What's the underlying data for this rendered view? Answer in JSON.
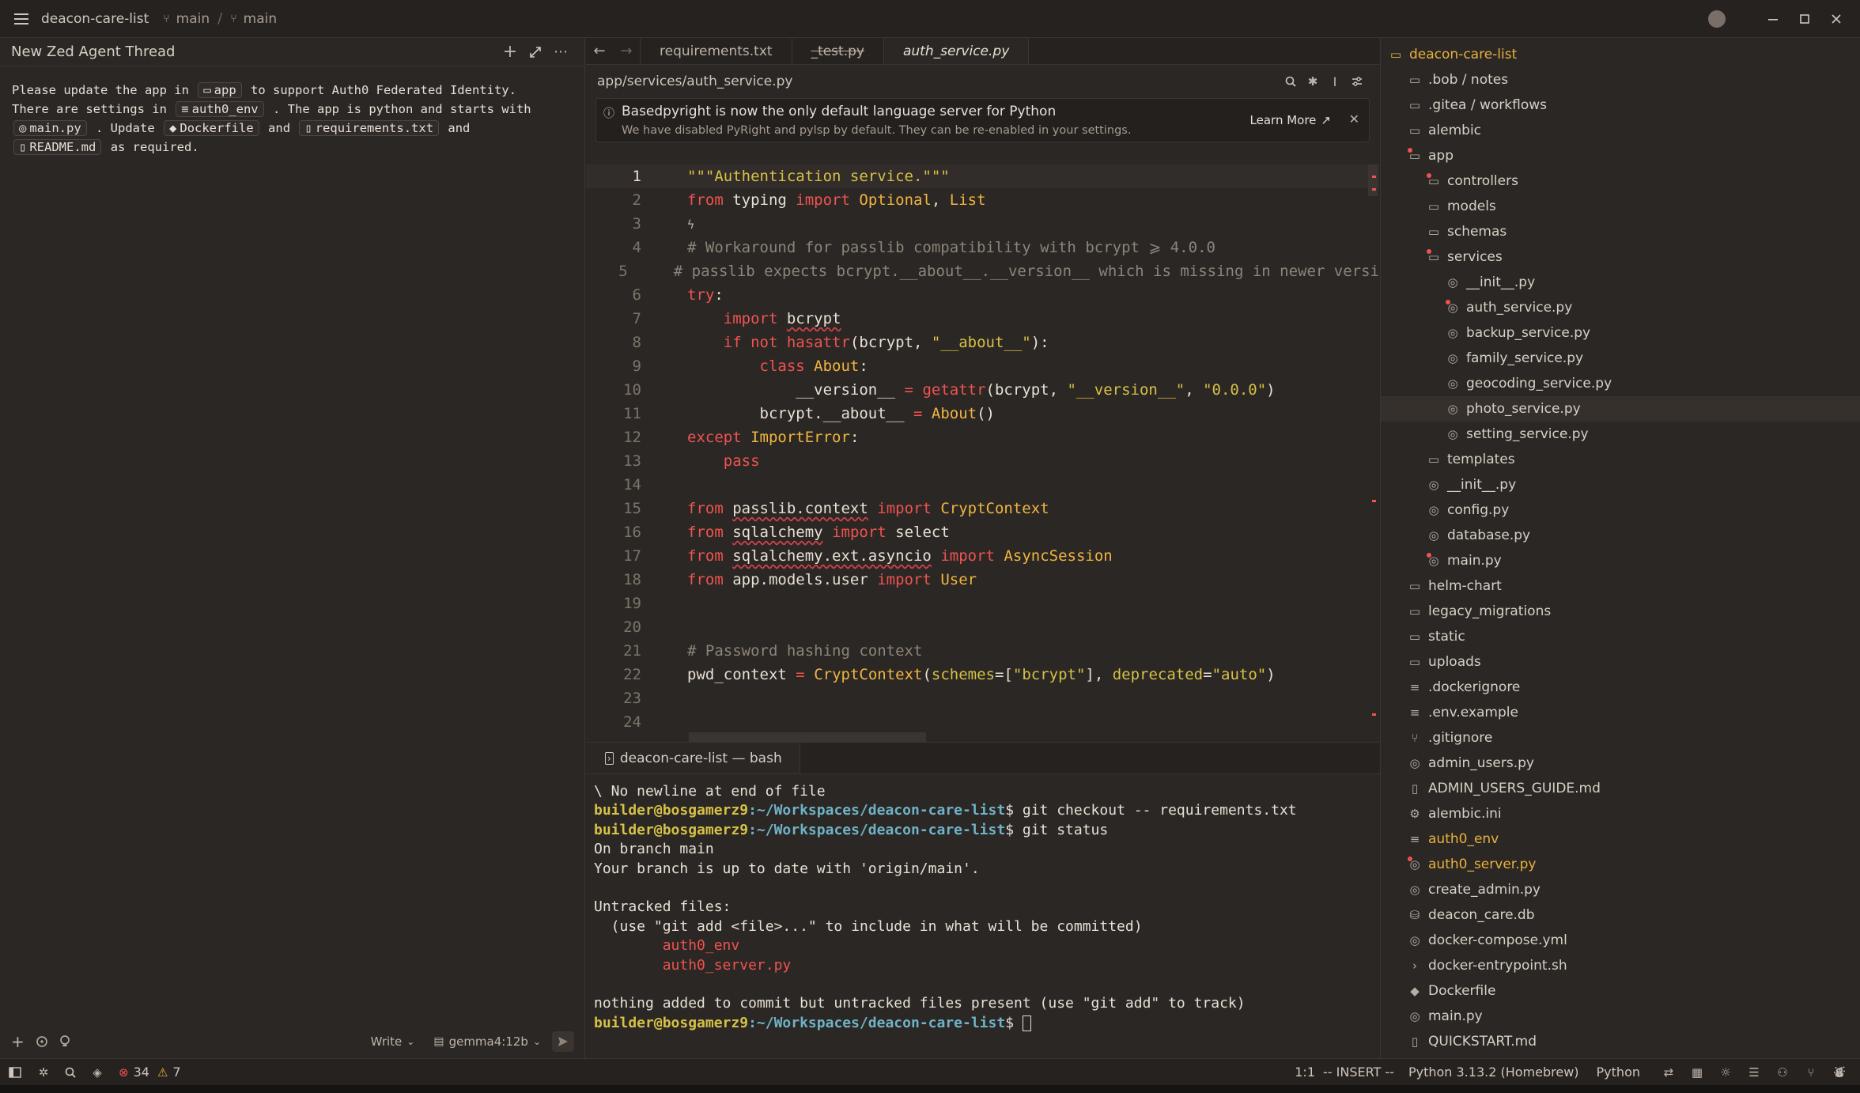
{
  "titlebar": {
    "project": "deacon-care-list",
    "branch1": "main",
    "branch2": "main"
  },
  "agent": {
    "title": "New Zed Agent Thread",
    "message": {
      "p1": "Please update the app in",
      "chip_app": "app",
      "p2": "to support Auth0 Federated Identity.",
      "p3": "There are settings in",
      "chip_env": "auth0_env",
      "p4": ". The app is python and starts with",
      "chip_main": "main.py",
      "p5": ". Update",
      "chip_docker": "Dockerfile",
      "p6": "and",
      "chip_req": "requirements.txt",
      "p7": "and",
      "chip_readme": "README.md",
      "p8": "as required."
    },
    "footer": {
      "mode": "Write",
      "model": "gemma4:12b"
    }
  },
  "editor": {
    "tabs": [
      {
        "label": "requirements.txt"
      },
      {
        "label": "_test.py"
      },
      {
        "label": "auth_service.py"
      }
    ],
    "path": "app/services/auth_service.py",
    "notice": {
      "title": "Basedpyright is now the only default language server for Python",
      "body": "We have disabled PyRight and pylsp by default. They can be re-enabled in your settings.",
      "learn_more": "Learn More"
    },
    "line_numbers": [
      "1",
      "2",
      "3",
      "4",
      "5",
      "6",
      "7",
      "8",
      "9",
      "10",
      "11",
      "12",
      "13",
      "14",
      "15",
      "16",
      "17",
      "18",
      "19",
      "20",
      "21",
      "22",
      "23",
      "24"
    ]
  },
  "terminal": {
    "tab": "deacon-care-list — bash",
    "lines": {
      "l1": "\\ No newline at end of file",
      "user": "builder@bosgamerz9",
      "path": ":~/Workspaces/deacon-care-list",
      "cmd1": "$ git checkout -- requirements.txt",
      "cmd2": "$ git status",
      "l4": "On branch main",
      "l5": "Your branch is up to date with 'origin/main'.",
      "l7": "Untracked files:",
      "l8": "  (use \"git add <file>...\" to include in what will be committed)",
      "u1": "        auth0_env",
      "u2": "        auth0_server.py",
      "l11": "nothing added to commit but untracked files present (use \"git add\" to track)",
      "cmd3": "$ "
    }
  },
  "project": {
    "root": "deacon-care-list",
    "items": [
      {
        "label": ".bob / notes"
      },
      {
        "label": ".gitea / workflows"
      },
      {
        "label": "alembic"
      },
      {
        "label": "app"
      },
      {
        "label": "controllers"
      },
      {
        "label": "models"
      },
      {
        "label": "schemas"
      },
      {
        "label": "services"
      },
      {
        "label": "__init__.py"
      },
      {
        "label": "auth_service.py"
      },
      {
        "label": "backup_service.py"
      },
      {
        "label": "family_service.py"
      },
      {
        "label": "geocoding_service.py"
      },
      {
        "label": "photo_service.py"
      },
      {
        "label": "setting_service.py"
      },
      {
        "label": "templates"
      },
      {
        "label": "__init__.py"
      },
      {
        "label": "config.py"
      },
      {
        "label": "database.py"
      },
      {
        "label": "main.py"
      },
      {
        "label": "helm-chart"
      },
      {
        "label": "legacy_migrations"
      },
      {
        "label": "static"
      },
      {
        "label": "uploads"
      },
      {
        "label": ".dockerignore"
      },
      {
        "label": ".env.example"
      },
      {
        "label": ".gitignore"
      },
      {
        "label": "admin_users.py"
      },
      {
        "label": "ADMIN_USERS_GUIDE.md"
      },
      {
        "label": "alembic.ini"
      },
      {
        "label": "auth0_env"
      },
      {
        "label": "auth0_server.py"
      },
      {
        "label": "create_admin.py"
      },
      {
        "label": "deacon_care.db"
      },
      {
        "label": "docker-compose.yml"
      },
      {
        "label": "docker-entrypoint.sh"
      },
      {
        "label": "Dockerfile"
      },
      {
        "label": "main.py"
      },
      {
        "label": "QUICKSTART.md"
      }
    ]
  },
  "statusbar": {
    "errors": "34",
    "warnings": "7",
    "position": "1:1",
    "mode": "-- INSERT --",
    "python_version": "Python 3.13.2 (Homebrew)",
    "language": "Python"
  },
  "colors": {
    "accent_yellow": "#e8b13e",
    "keyword_red": "#ef5350",
    "string_yellow": "#d6c146",
    "background": "#2b2724"
  }
}
